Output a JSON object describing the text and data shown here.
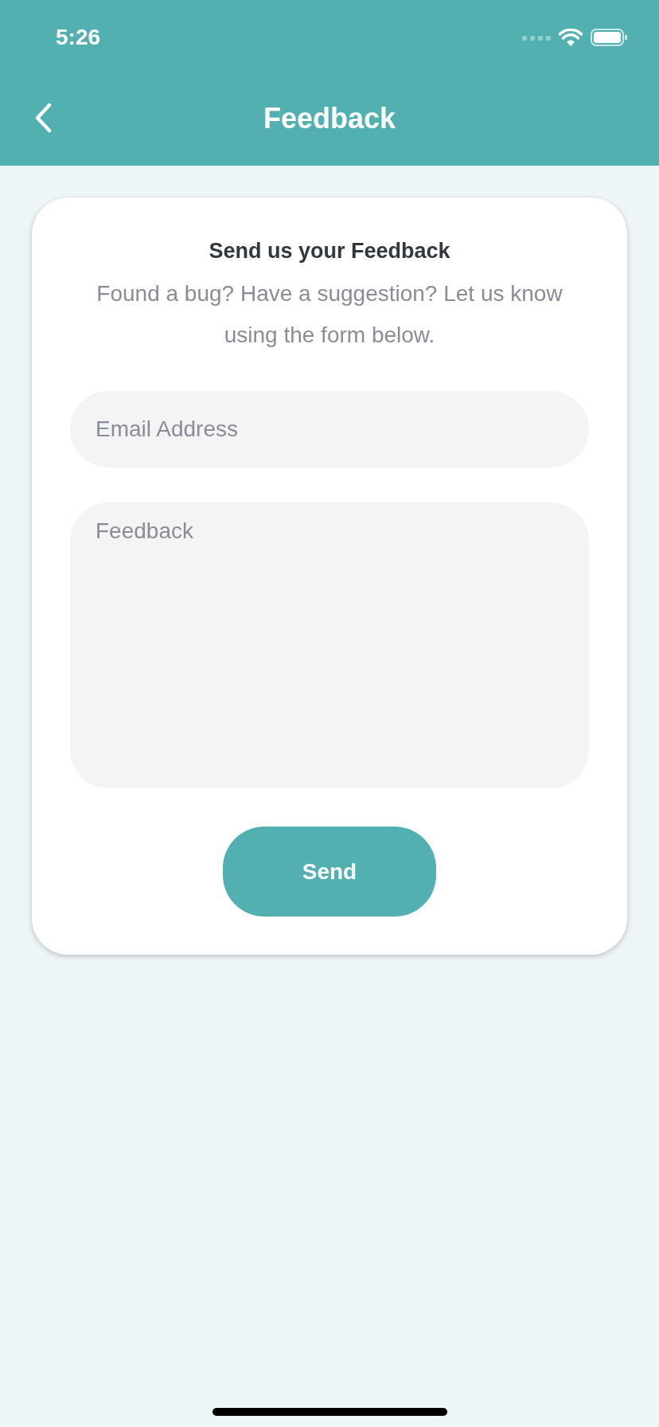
{
  "status_bar": {
    "time": "5:26"
  },
  "nav_bar": {
    "title": "Feedback"
  },
  "card": {
    "title": "Send us your Feedback",
    "description": "Found a bug? Have a suggestion? Let us know using the form below.",
    "email_field": {
      "placeholder": "Email Address"
    },
    "feedback_field": {
      "placeholder": "Feedback"
    },
    "send_button": {
      "label": "Send"
    }
  }
}
